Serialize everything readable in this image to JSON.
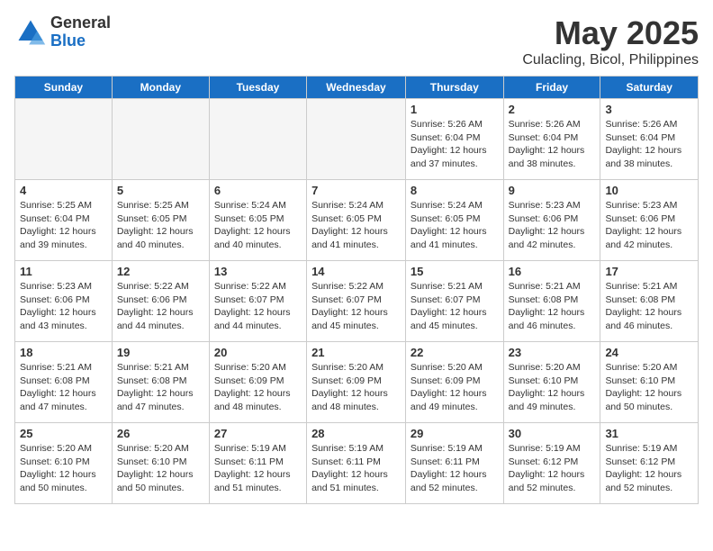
{
  "header": {
    "logo_general": "General",
    "logo_blue": "Blue",
    "month_title": "May 2025",
    "subtitle": "Culacling, Bicol, Philippines"
  },
  "days_of_week": [
    "Sunday",
    "Monday",
    "Tuesday",
    "Wednesday",
    "Thursday",
    "Friday",
    "Saturday"
  ],
  "weeks": [
    [
      {
        "day": "",
        "info": ""
      },
      {
        "day": "",
        "info": ""
      },
      {
        "day": "",
        "info": ""
      },
      {
        "day": "",
        "info": ""
      },
      {
        "day": "1",
        "info": "Sunrise: 5:26 AM\nSunset: 6:04 PM\nDaylight: 12 hours\nand 37 minutes."
      },
      {
        "day": "2",
        "info": "Sunrise: 5:26 AM\nSunset: 6:04 PM\nDaylight: 12 hours\nand 38 minutes."
      },
      {
        "day": "3",
        "info": "Sunrise: 5:26 AM\nSunset: 6:04 PM\nDaylight: 12 hours\nand 38 minutes."
      }
    ],
    [
      {
        "day": "4",
        "info": "Sunrise: 5:25 AM\nSunset: 6:04 PM\nDaylight: 12 hours\nand 39 minutes."
      },
      {
        "day": "5",
        "info": "Sunrise: 5:25 AM\nSunset: 6:05 PM\nDaylight: 12 hours\nand 40 minutes."
      },
      {
        "day": "6",
        "info": "Sunrise: 5:24 AM\nSunset: 6:05 PM\nDaylight: 12 hours\nand 40 minutes."
      },
      {
        "day": "7",
        "info": "Sunrise: 5:24 AM\nSunset: 6:05 PM\nDaylight: 12 hours\nand 41 minutes."
      },
      {
        "day": "8",
        "info": "Sunrise: 5:24 AM\nSunset: 6:05 PM\nDaylight: 12 hours\nand 41 minutes."
      },
      {
        "day": "9",
        "info": "Sunrise: 5:23 AM\nSunset: 6:06 PM\nDaylight: 12 hours\nand 42 minutes."
      },
      {
        "day": "10",
        "info": "Sunrise: 5:23 AM\nSunset: 6:06 PM\nDaylight: 12 hours\nand 42 minutes."
      }
    ],
    [
      {
        "day": "11",
        "info": "Sunrise: 5:23 AM\nSunset: 6:06 PM\nDaylight: 12 hours\nand 43 minutes."
      },
      {
        "day": "12",
        "info": "Sunrise: 5:22 AM\nSunset: 6:06 PM\nDaylight: 12 hours\nand 44 minutes."
      },
      {
        "day": "13",
        "info": "Sunrise: 5:22 AM\nSunset: 6:07 PM\nDaylight: 12 hours\nand 44 minutes."
      },
      {
        "day": "14",
        "info": "Sunrise: 5:22 AM\nSunset: 6:07 PM\nDaylight: 12 hours\nand 45 minutes."
      },
      {
        "day": "15",
        "info": "Sunrise: 5:21 AM\nSunset: 6:07 PM\nDaylight: 12 hours\nand 45 minutes."
      },
      {
        "day": "16",
        "info": "Sunrise: 5:21 AM\nSunset: 6:08 PM\nDaylight: 12 hours\nand 46 minutes."
      },
      {
        "day": "17",
        "info": "Sunrise: 5:21 AM\nSunset: 6:08 PM\nDaylight: 12 hours\nand 46 minutes."
      }
    ],
    [
      {
        "day": "18",
        "info": "Sunrise: 5:21 AM\nSunset: 6:08 PM\nDaylight: 12 hours\nand 47 minutes."
      },
      {
        "day": "19",
        "info": "Sunrise: 5:21 AM\nSunset: 6:08 PM\nDaylight: 12 hours\nand 47 minutes."
      },
      {
        "day": "20",
        "info": "Sunrise: 5:20 AM\nSunset: 6:09 PM\nDaylight: 12 hours\nand 48 minutes."
      },
      {
        "day": "21",
        "info": "Sunrise: 5:20 AM\nSunset: 6:09 PM\nDaylight: 12 hours\nand 48 minutes."
      },
      {
        "day": "22",
        "info": "Sunrise: 5:20 AM\nSunset: 6:09 PM\nDaylight: 12 hours\nand 49 minutes."
      },
      {
        "day": "23",
        "info": "Sunrise: 5:20 AM\nSunset: 6:10 PM\nDaylight: 12 hours\nand 49 minutes."
      },
      {
        "day": "24",
        "info": "Sunrise: 5:20 AM\nSunset: 6:10 PM\nDaylight: 12 hours\nand 50 minutes."
      }
    ],
    [
      {
        "day": "25",
        "info": "Sunrise: 5:20 AM\nSunset: 6:10 PM\nDaylight: 12 hours\nand 50 minutes."
      },
      {
        "day": "26",
        "info": "Sunrise: 5:20 AM\nSunset: 6:10 PM\nDaylight: 12 hours\nand 50 minutes."
      },
      {
        "day": "27",
        "info": "Sunrise: 5:19 AM\nSunset: 6:11 PM\nDaylight: 12 hours\nand 51 minutes."
      },
      {
        "day": "28",
        "info": "Sunrise: 5:19 AM\nSunset: 6:11 PM\nDaylight: 12 hours\nand 51 minutes."
      },
      {
        "day": "29",
        "info": "Sunrise: 5:19 AM\nSunset: 6:11 PM\nDaylight: 12 hours\nand 52 minutes."
      },
      {
        "day": "30",
        "info": "Sunrise: 5:19 AM\nSunset: 6:12 PM\nDaylight: 12 hours\nand 52 minutes."
      },
      {
        "day": "31",
        "info": "Sunrise: 5:19 AM\nSunset: 6:12 PM\nDaylight: 12 hours\nand 52 minutes."
      }
    ]
  ]
}
